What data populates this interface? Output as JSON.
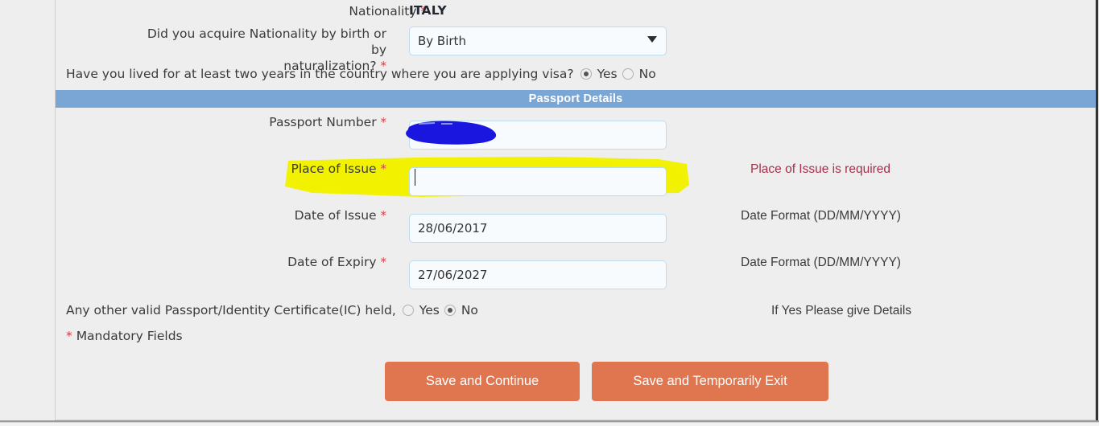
{
  "form": {
    "nationality": {
      "label": "Nationality",
      "required_mark": "*",
      "value": "ITALY"
    },
    "acquire_nationality": {
      "label_line1": "Did you acquire Nationality by birth or by",
      "label_line2": "naturalization?",
      "required_mark": "*",
      "selected": "By Birth",
      "options": [
        "By Birth"
      ]
    },
    "lived_two_years": {
      "question": "Have you lived for at least two years in the country where you are applying visa?",
      "yes_label": "Yes",
      "no_label": "No",
      "selected": "Yes"
    }
  },
  "passport_section": {
    "header": "Passport Details",
    "header_bg": "#7aa6d6",
    "passport_number": {
      "label": "Passport Number",
      "required_mark": "*",
      "value": "",
      "redacted": true
    },
    "place_of_issue": {
      "label": "Place of Issue",
      "required_mark": "*",
      "value": "",
      "focused": true,
      "error": "Place of Issue is required",
      "error_color": "#a5304a",
      "highlighted": true,
      "highlight_color": "#f2f200"
    },
    "date_of_issue": {
      "label": "Date of Issue",
      "required_mark": "*",
      "value": "28/06/2017",
      "hint": "Date Format (DD/MM/YYYY)"
    },
    "date_of_expiry": {
      "label": "Date of Expiry",
      "required_mark": "*",
      "value": "27/06/2027",
      "hint": "Date Format (DD/MM/YYYY)"
    },
    "other_passport": {
      "question": "Any other valid Passport/Identity Certificate(IC) held,",
      "yes_label": "Yes",
      "no_label": "No",
      "selected": "No",
      "hint": "If Yes Please give Details"
    },
    "mandatory_note_star": "*",
    "mandatory_note": "Mandatory Fields"
  },
  "actions": {
    "save_continue": "Save and Continue",
    "save_exit": "Save and Temporarily Exit",
    "button_color": "#e0764f"
  },
  "annotations": {
    "blue_redaction_color": "#1a16e0",
    "yellow_highlight_color": "#f2f200"
  }
}
